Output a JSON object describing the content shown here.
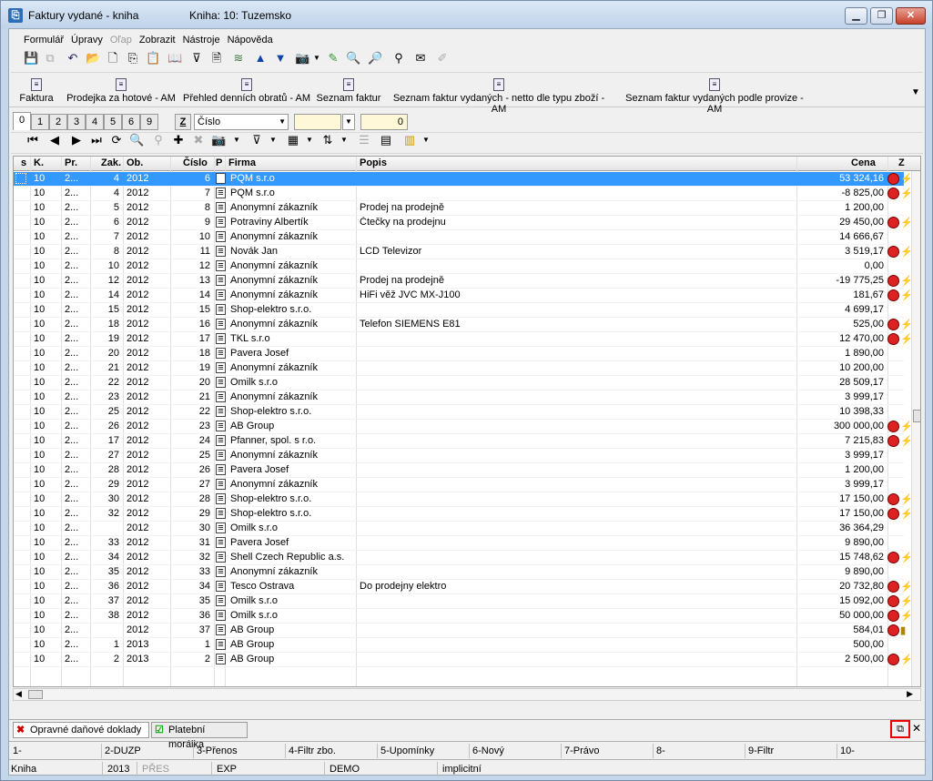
{
  "window": {
    "title": "Faktury vydané - kniha",
    "subtitle": "Kniha: 10: Tuzemsko",
    "app_icon": "app-icon",
    "min_label": "▁",
    "max_label": "❐",
    "close_label": "✕"
  },
  "menu": [
    "Formulář",
    "Úpravy",
    "Oľap",
    "Zobrazit",
    "Nástroje",
    "Nápověda"
  ],
  "reports": [
    "Faktura",
    "Prodejka za hotové - AM",
    "Přehled denních obratů - AM",
    "Seznam faktur",
    "Seznam faktur vydaných - netto dle typu zboží - AM",
    "Seznam faktur vydaných podle provize - AM"
  ],
  "tabs": [
    "0",
    "1",
    "2",
    "3",
    "4",
    "5",
    "6",
    "9"
  ],
  "filter": {
    "z_label": "Z",
    "sort_field": "Číslo",
    "value": "0"
  },
  "columns": {
    "s": "s",
    "k": "K.",
    "pr": "Pr.",
    "zak": "Zak.",
    "ob": "Ob.",
    "cislo": "Číslo",
    "p": "P",
    "firma": "Firma",
    "popis": "Popis",
    "cena": "Cena",
    "z": "Z"
  },
  "rows": [
    {
      "k": "10",
      "pr": "2...",
      "zak": "4",
      "ob": "2012",
      "cislo": "6",
      "firma": "PQM s.r.o",
      "popis": "",
      "cena": "53 324,16",
      "icons": "red-green"
    },
    {
      "k": "10",
      "pr": "2...",
      "zak": "4",
      "ob": "2012",
      "cislo": "7",
      "firma": "PQM s.r.o",
      "popis": "",
      "cena": "-8 825,00",
      "icons": "red-green"
    },
    {
      "k": "10",
      "pr": "2...",
      "zak": "5",
      "ob": "2012",
      "cislo": "8",
      "firma": "Anonymní zákazník",
      "popis": "Prodej na prodejně",
      "cena": "1 200,00",
      "icons": ""
    },
    {
      "k": "10",
      "pr": "2...",
      "zak": "6",
      "ob": "2012",
      "cislo": "9",
      "firma": "Potraviny Albertík",
      "popis": "Čtečky na prodejnu",
      "cena": "29 450,00",
      "icons": "red-green"
    },
    {
      "k": "10",
      "pr": "2...",
      "zak": "7",
      "ob": "2012",
      "cislo": "10",
      "firma": "Anonymní zákazník",
      "popis": "",
      "cena": "14 666,67",
      "icons": ""
    },
    {
      "k": "10",
      "pr": "2...",
      "zak": "8",
      "ob": "2012",
      "cislo": "11",
      "firma": "Novák Jan",
      "popis": "LCD Televizor",
      "cena": "3 519,17",
      "icons": "red-green"
    },
    {
      "k": "10",
      "pr": "2...",
      "zak": "10",
      "ob": "2012",
      "cislo": "12",
      "firma": "Anonymní zákazník",
      "popis": "",
      "cena": "0,00",
      "icons": ""
    },
    {
      "k": "10",
      "pr": "2...",
      "zak": "12",
      "ob": "2012",
      "cislo": "13",
      "firma": "Anonymní zákazník",
      "popis": "Prodej na prodejně",
      "cena": "-19 775,25",
      "icons": "red-green"
    },
    {
      "k": "10",
      "pr": "2...",
      "zak": "14",
      "ob": "2012",
      "cislo": "14",
      "firma": "Anonymní zákazník",
      "popis": "HiFi věž JVC MX-J100",
      "cena": "181,67",
      "icons": "red-green"
    },
    {
      "k": "10",
      "pr": "2...",
      "zak": "15",
      "ob": "2012",
      "cislo": "15",
      "firma": "Shop-elektro s.r.o.",
      "popis": "",
      "cena": "4 699,17",
      "icons": ""
    },
    {
      "k": "10",
      "pr": "2...",
      "zak": "18",
      "ob": "2012",
      "cislo": "16",
      "firma": "Anonymní zákazník",
      "popis": "Telefon SIEMENS E81",
      "cena": "525,00",
      "icons": "red-green"
    },
    {
      "k": "10",
      "pr": "2...",
      "zak": "19",
      "ob": "2012",
      "cislo": "17",
      "firma": "TKL s.r.o",
      "popis": "",
      "cena": "12 470,00",
      "icons": "red-green"
    },
    {
      "k": "10",
      "pr": "2...",
      "zak": "20",
      "ob": "2012",
      "cislo": "18",
      "firma": "Pavera Josef",
      "popis": "",
      "cena": "1 890,00",
      "icons": ""
    },
    {
      "k": "10",
      "pr": "2...",
      "zak": "21",
      "ob": "2012",
      "cislo": "19",
      "firma": "Anonymní zákazník",
      "popis": "",
      "cena": "10 200,00",
      "icons": ""
    },
    {
      "k": "10",
      "pr": "2...",
      "zak": "22",
      "ob": "2012",
      "cislo": "20",
      "firma": "Omilk s.r.o",
      "popis": "",
      "cena": "28 509,17",
      "icons": ""
    },
    {
      "k": "10",
      "pr": "2...",
      "zak": "23",
      "ob": "2012",
      "cislo": "21",
      "firma": "Anonymní zákazník",
      "popis": "",
      "cena": "3 999,17",
      "icons": ""
    },
    {
      "k": "10",
      "pr": "2...",
      "zak": "25",
      "ob": "2012",
      "cislo": "22",
      "firma": "Shop-elektro s.r.o.",
      "popis": "",
      "cena": "10 398,33",
      "icons": ""
    },
    {
      "k": "10",
      "pr": "2...",
      "zak": "26",
      "ob": "2012",
      "cislo": "23",
      "firma": "AB Group",
      "popis": "",
      "cena": "300 000,00",
      "icons": "red-green"
    },
    {
      "k": "10",
      "pr": "2...",
      "zak": "17",
      "ob": "2012",
      "cislo": "24",
      "firma": "Pfanner, spol. s r.o.",
      "popis": "",
      "cena": "7 215,83",
      "icons": "red-green"
    },
    {
      "k": "10",
      "pr": "2...",
      "zak": "27",
      "ob": "2012",
      "cislo": "25",
      "firma": "Anonymní zákazník",
      "popis": "",
      "cena": "3 999,17",
      "icons": ""
    },
    {
      "k": "10",
      "pr": "2...",
      "zak": "28",
      "ob": "2012",
      "cislo": "26",
      "firma": "Pavera Josef",
      "popis": "",
      "cena": "1 200,00",
      "icons": ""
    },
    {
      "k": "10",
      "pr": "2...",
      "zak": "29",
      "ob": "2012",
      "cislo": "27",
      "firma": "Anonymní zákazník",
      "popis": "",
      "cena": "3 999,17",
      "icons": ""
    },
    {
      "k": "10",
      "pr": "2...",
      "zak": "30",
      "ob": "2012",
      "cislo": "28",
      "firma": "Shop-elektro s.r.o.",
      "popis": "",
      "cena": "17 150,00",
      "icons": "red-green"
    },
    {
      "k": "10",
      "pr": "2...",
      "zak": "32",
      "ob": "2012",
      "cislo": "29",
      "firma": "Shop-elektro s.r.o.",
      "popis": "",
      "cena": "17 150,00",
      "icons": "red-green"
    },
    {
      "k": "10",
      "pr": "2...",
      "zak": "",
      "ob": "2012",
      "cislo": "30",
      "firma": "Omilk s.r.o",
      "popis": "",
      "cena": "36 364,29",
      "icons": ""
    },
    {
      "k": "10",
      "pr": "2...",
      "zak": "33",
      "ob": "2012",
      "cislo": "31",
      "firma": "Pavera Josef",
      "popis": "",
      "cena": "9 890,00",
      "icons": ""
    },
    {
      "k": "10",
      "pr": "2...",
      "zak": "34",
      "ob": "2012",
      "cislo": "32",
      "firma": "Shell Czech Republic a.s.",
      "popis": "",
      "cena": "15 748,62",
      "icons": "red-green"
    },
    {
      "k": "10",
      "pr": "2...",
      "zak": "35",
      "ob": "2012",
      "cislo": "33",
      "firma": "Anonymní zákazník",
      "popis": "",
      "cena": "9 890,00",
      "icons": ""
    },
    {
      "k": "10",
      "pr": "2...",
      "zak": "36",
      "ob": "2012",
      "cislo": "34",
      "firma": "Tesco Ostrava",
      "popis": "Do prodejny elektro",
      "cena": "20 732,80",
      "icons": "red-green"
    },
    {
      "k": "10",
      "pr": "2...",
      "zak": "37",
      "ob": "2012",
      "cislo": "35",
      "firma": "Omilk s.r.o",
      "popis": "",
      "cena": "15 092,00",
      "icons": "red-green"
    },
    {
      "k": "10",
      "pr": "2...",
      "zak": "38",
      "ob": "2012",
      "cislo": "36",
      "firma": "Omilk s.r.o",
      "popis": "",
      "cena": "50 000,00",
      "icons": "red-green"
    },
    {
      "k": "10",
      "pr": "2...",
      "zak": "",
      "ob": "2012",
      "cislo": "37",
      "firma": "AB Group",
      "popis": "",
      "cena": "584,01",
      "icons": "red-yellow"
    },
    {
      "k": "10",
      "pr": "2...",
      "zak": "1",
      "ob": "2013",
      "cislo": "1",
      "firma": "AB Group",
      "popis": "",
      "cena": "500,00",
      "icons": ""
    },
    {
      "k": "10",
      "pr": "2...",
      "zak": "2",
      "ob": "2013",
      "cislo": "2",
      "firma": "AB Group",
      "popis": "",
      "cena": "2 500,00",
      "icons": "red-green"
    }
  ],
  "bottom_tabs": [
    "Opravné daňové doklady",
    "Platební morálka"
  ],
  "fkeys": [
    "1-",
    "2-DUZP",
    "3-Přenos",
    "4-Filtr zbo.",
    "5-Upomínky",
    "6-Nový",
    "7-Právo",
    "8-",
    "9-Filtr",
    "10-"
  ],
  "status": [
    "Kniha",
    "2013",
    "PŘES",
    "EXP",
    "DEMO",
    "implicitní"
  ]
}
